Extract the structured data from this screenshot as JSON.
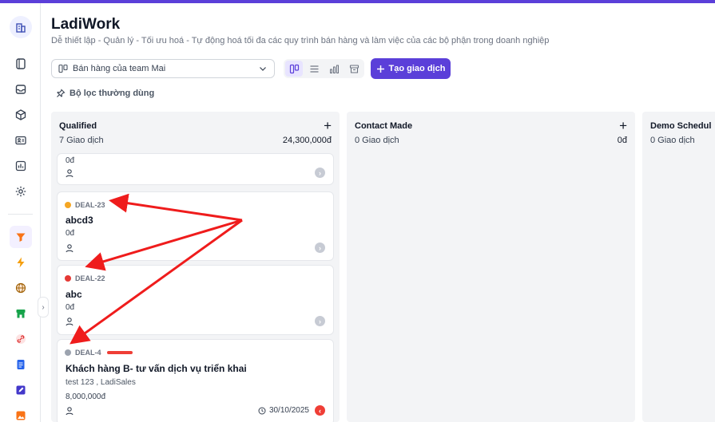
{
  "app": {
    "title": "LadiWork",
    "subtitle": "Dễ thiết lập - Quản lý - Tối ưu hoá - Tự động hoá tối đa các quy trình bán hàng và làm việc của các bộ phận trong doanh nghiệp",
    "accent_color": "#5b3fd9"
  },
  "sidebar": {
    "top_icon": "building-icon",
    "items": [
      {
        "icon": "book-icon"
      },
      {
        "icon": "inbox-icon"
      },
      {
        "icon": "box-icon"
      },
      {
        "icon": "contact-card-icon"
      },
      {
        "icon": "report-icon"
      },
      {
        "icon": "settings-icon"
      }
    ],
    "apps": [
      {
        "icon": "funnel-icon",
        "active": true
      },
      {
        "icon": "lightning-icon"
      },
      {
        "icon": "globe-icon"
      },
      {
        "icon": "store-icon"
      },
      {
        "icon": "link-icon"
      },
      {
        "icon": "document-icon"
      },
      {
        "icon": "edit-icon"
      },
      {
        "icon": "image-icon"
      }
    ]
  },
  "toolbar": {
    "pipeline_select": "Bán hàng của team Mai",
    "views": [
      "kanban-view-icon",
      "list-view-icon",
      "chart-view-icon",
      "archive-icon"
    ],
    "create_button": "Tạo giao dịch",
    "filter_label": "Bộ lọc thường dùng"
  },
  "columns": [
    {
      "title": "Qualified",
      "count": "7 Giao dịch",
      "total": "24,300,000đ",
      "cards": [
        {
          "partial": true,
          "amount": "0đ"
        },
        {
          "code": "DEAL-23",
          "dot_color": "#f5a623",
          "name": "abcd3",
          "amount": "0đ"
        },
        {
          "code": "DEAL-22",
          "dot_color": "#e53935",
          "name": "abc",
          "amount": "0đ"
        },
        {
          "code": "DEAL-4",
          "dot_color": "#9ca3af",
          "name": "Khách hàng B- tư vấn dịch vụ triển khai",
          "sub": "test 123 , LadiSales",
          "amount": "8,000,000đ",
          "date": "30/10/2025"
        }
      ]
    },
    {
      "title": "Contact Made",
      "count": "0 Giao dịch",
      "total": "0đ"
    },
    {
      "title": "Demo Schedul",
      "count": "0 Giao dịch"
    }
  ],
  "annotations": {
    "arrow_color": "#ef1c1c"
  }
}
